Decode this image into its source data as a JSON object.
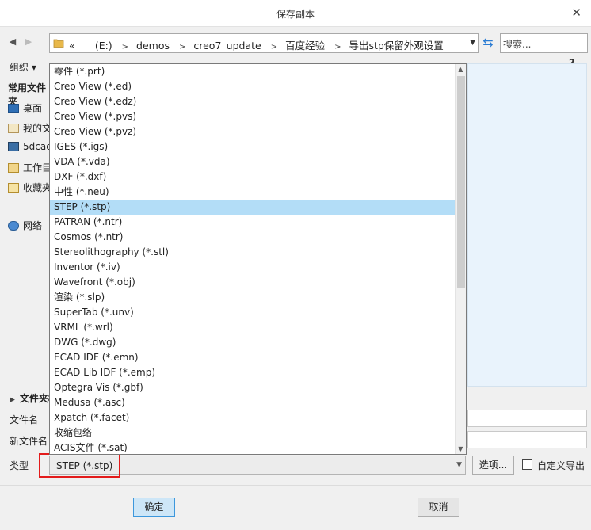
{
  "window": {
    "title": "保存副本",
    "close_glyph": "✕"
  },
  "address": {
    "overflow_glyph": "«",
    "crumbs": [
      "(E:)",
      "demos",
      "creo7_update",
      "百度经验",
      "导出stp保留外观设置"
    ],
    "search_placeholder": "搜索..."
  },
  "toolbar": {
    "organize_label": "组织 ▾",
    "views_label": "视图  ▾  工具",
    "help_label": "?"
  },
  "sidebar": {
    "header": "常用文件夹",
    "items": [
      {
        "label": "桌面",
        "icon": "desktop-icon"
      },
      {
        "label": "我的文档",
        "icon": "documents-icon"
      },
      {
        "label": "5dcad",
        "icon": "computer-icon"
      },
      {
        "label": "工作目录",
        "icon": "working-dir-icon"
      },
      {
        "label": "收藏夹",
        "icon": "favorites-icon"
      },
      {
        "label": "网络",
        "icon": "network-icon"
      }
    ]
  },
  "folders_toggle": {
    "label": "文件夹树"
  },
  "form": {
    "filename_label": "文件名",
    "new_filename_label": "新文件名",
    "type_label": "类型",
    "type_value": "STEP (*.stp)",
    "options_button": "选项...",
    "custom_export_label": "自定义导出",
    "ok_button": "确定",
    "cancel_button": "取消"
  },
  "type_options": [
    "零件 (*.prt)",
    "Creo View (*.ed)",
    "Creo View (*.edz)",
    "Creo View (*.pvs)",
    "Creo View (*.pvz)",
    "IGES (*.igs)",
    "VDA (*.vda)",
    "DXF (*.dxf)",
    "中性 (*.neu)",
    "STEP (*.stp)",
    "PATRAN (*.ntr)",
    "Cosmos (*.ntr)",
    "Stereolithography (*.stl)",
    "Inventor (*.iv)",
    "Wavefront (*.obj)",
    "渲染 (*.slp)",
    "SuperTab (*.unv)",
    "VRML (*.wrl)",
    "DWG (*.dwg)",
    "ECAD IDF (*.emn)",
    "ECAD Lib IDF (*.emp)",
    "Optegra Vis (*.gbf)",
    "Medusa (*.asc)",
    "Xpatch (*.facet)",
    "收缩包络",
    "ACIS文件 (*.sat)"
  ],
  "selected_type_index": 9,
  "colors": {
    "highlight_border": "#e31b1b",
    "selection": "#b3ddf7",
    "ok_button": "#cde6f7"
  }
}
